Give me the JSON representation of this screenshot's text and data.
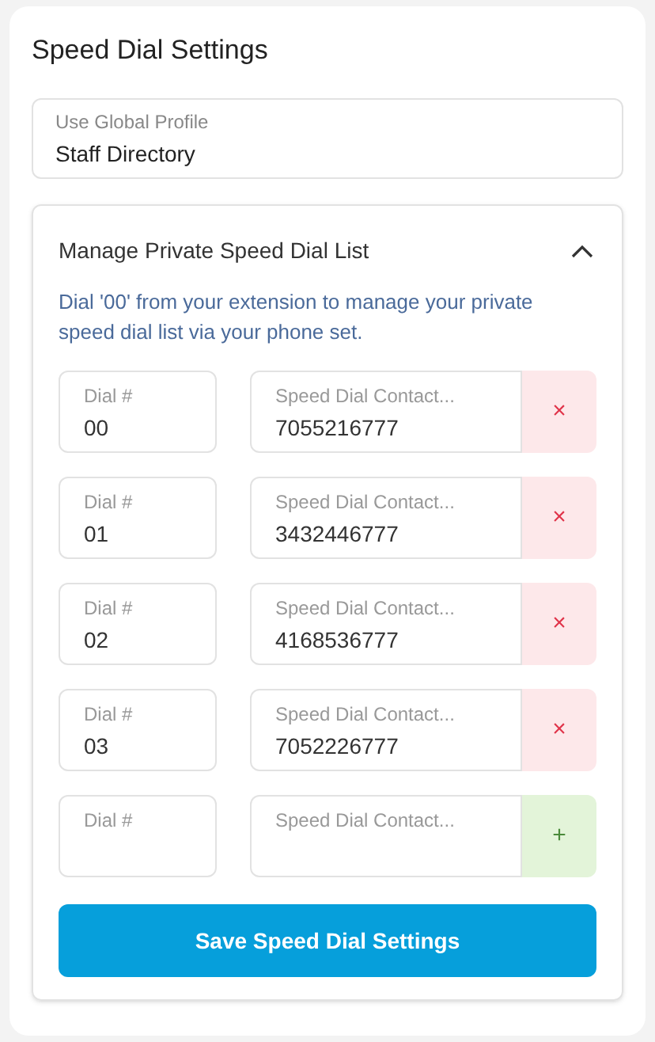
{
  "title": "Speed Dial Settings",
  "profile_field": {
    "label": "Use Global Profile",
    "value": "Staff Directory"
  },
  "panel": {
    "title": "Manage Private Speed Dial List",
    "expanded": true,
    "description": "Dial '00' from your extension to manage your private speed dial list via your phone set.",
    "rows": [
      {
        "kind": "entry",
        "dial": {
          "label": "Dial #",
          "value": "00"
        },
        "contact": {
          "label": "Speed Dial Contact...",
          "value": "7055216777"
        },
        "action": "×"
      },
      {
        "kind": "entry",
        "dial": {
          "label": "Dial #",
          "value": "01"
        },
        "contact": {
          "label": "Speed Dial Contact...",
          "value": "3432446777"
        },
        "action": "×"
      },
      {
        "kind": "entry",
        "dial": {
          "label": "Dial #",
          "value": "02"
        },
        "contact": {
          "label": "Speed Dial Contact...",
          "value": "4168536777"
        },
        "action": "×"
      },
      {
        "kind": "entry",
        "dial": {
          "label": "Dial #",
          "value": "03"
        },
        "contact": {
          "label": "Speed Dial Contact...",
          "value": "7052226777"
        },
        "action": "×"
      },
      {
        "kind": "new",
        "dial": {
          "label": "Dial #"
        },
        "contact": {
          "label": "Speed Dial Contact..."
        },
        "action": "+"
      }
    ],
    "save_button": "Save Speed Dial Settings"
  }
}
